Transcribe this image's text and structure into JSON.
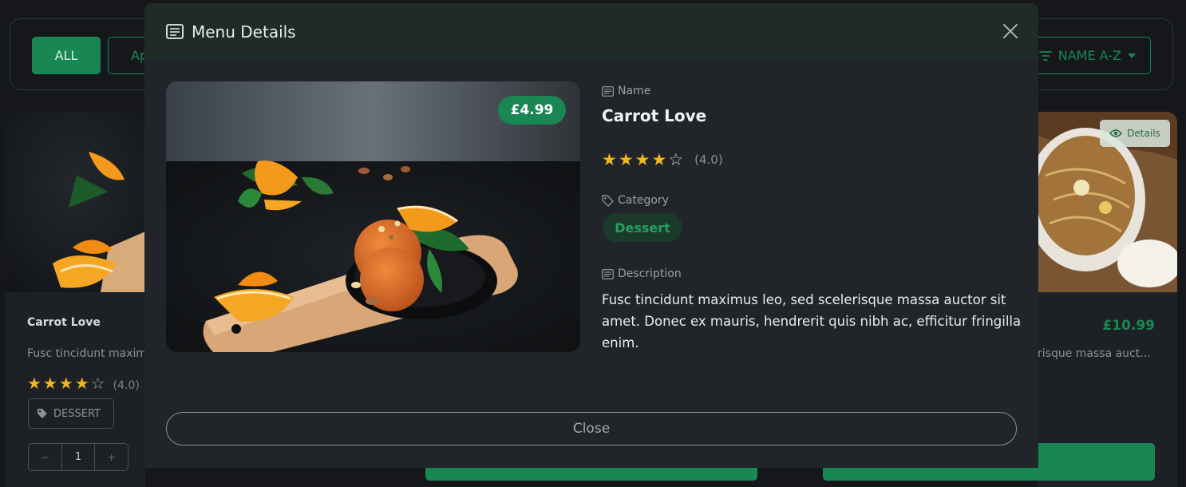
{
  "filters": {
    "all_label": "ALL",
    "appetizer_label": "Ap",
    "sort_label": "NAME A-Z"
  },
  "left_card": {
    "title": "Carrot Love",
    "description": "Fusc tincidunt maxim",
    "stars_filled": "★★★★",
    "stars_empty": "☆",
    "rating": "(4.0)",
    "tag": "DESSERT",
    "qty_minus": "−",
    "qty_value": "1",
    "qty_plus": "+"
  },
  "right_card": {
    "details_label": "Details",
    "price": "£10.99",
    "description": "risque massa auct..."
  },
  "modal": {
    "title": "Menu Details",
    "price": "£4.99",
    "name_label": "Name",
    "name": "Carrot Love",
    "stars_filled": "★★★★",
    "stars_empty": "☆",
    "rating": 4.0,
    "rating_label": "(4.0)",
    "category_label": "Category",
    "category": "Dessert",
    "description_label": "Description",
    "description": "Fusc tincidunt maximus leo, sed scelerisque massa auctor sit amet. Donec ex mauris, hendrerit quis nibh ac, efficitur fringilla enim.",
    "close_label": "Close"
  },
  "colors": {
    "accent": "#198754",
    "star": "#f4b51e",
    "background": "#15171b",
    "modal_bg": "#212529",
    "header_bg": "#1f2b27"
  }
}
